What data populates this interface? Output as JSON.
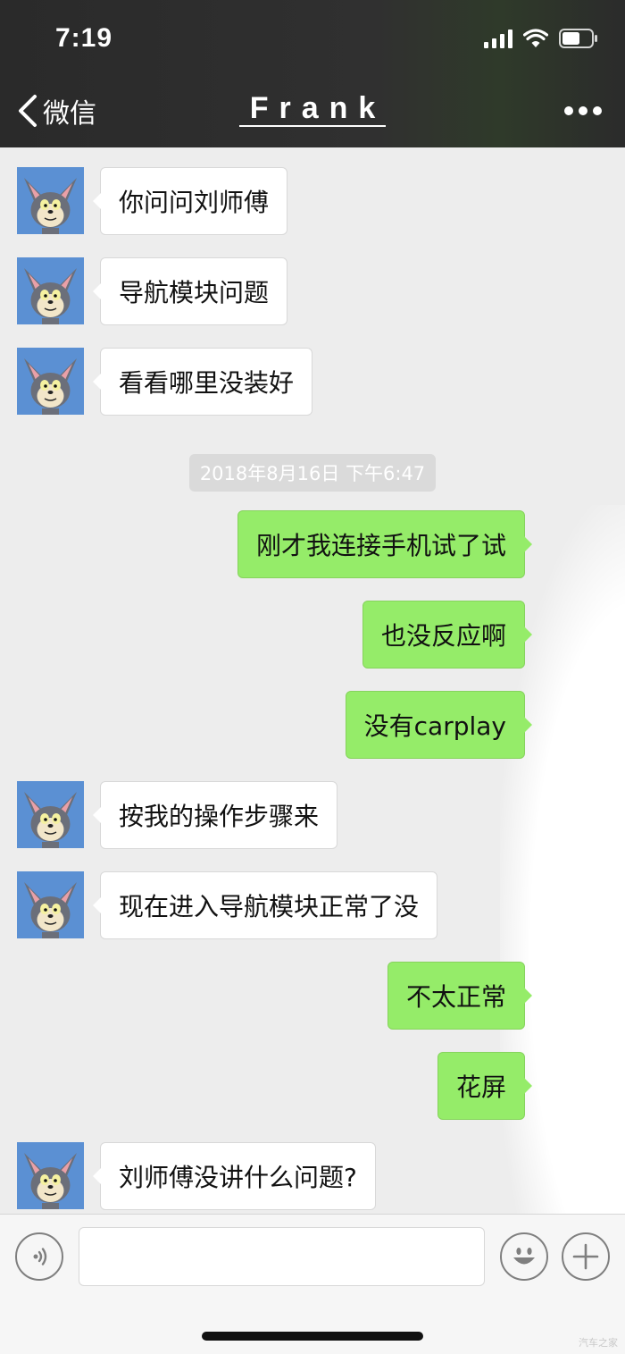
{
  "status": {
    "time": "7:19"
  },
  "nav": {
    "back_label": "微信",
    "title": "Frank"
  },
  "timestamp": "2018年8月16日 下午6:47",
  "messages_before": [
    {
      "text": "你问问刘师傅"
    },
    {
      "text": "导航模块问题"
    },
    {
      "text": "看看哪里没装好"
    }
  ],
  "messages_after": [
    {
      "dir": "out",
      "text": "刚才我连接手机试了试"
    },
    {
      "dir": "out",
      "text": "也没反应啊"
    },
    {
      "dir": "out",
      "text": "没有carplay"
    },
    {
      "dir": "in",
      "text": "按我的操作步骤来"
    },
    {
      "dir": "in",
      "text": "现在进入导航模块正常了没"
    },
    {
      "dir": "out",
      "text": "不太正常"
    },
    {
      "dir": "out",
      "text": "花屏"
    },
    {
      "dir": "in",
      "text": "刘师傅没讲什么问题?"
    }
  ],
  "input": {
    "value": ""
  },
  "watermark": "汽车之家",
  "colors": {
    "outgoing_bubble": "#95ec69",
    "incoming_bubble": "#ffffff",
    "header": "#2b2b2b",
    "chat_bg": "#ededed"
  },
  "icons": {
    "back": "chevron-left-icon",
    "more": "more-dots-icon",
    "voice": "voice-icon",
    "emoji": "emoji-icon",
    "plus": "plus-icon"
  }
}
